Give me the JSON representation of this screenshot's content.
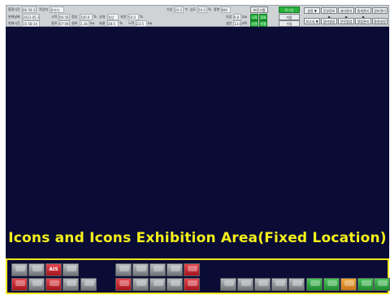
{
  "status_bar": {
    "row1": [
      "통합시간",
      "06:58:33",
      "작업자",
      "관리자",
      "기상",
      "20.0",
      "℃",
      "습도",
      "50.0",
      "%",
      "풍향",
      "NW",
      "프로그램",
      "로그인"
    ],
    "row2": [
      "현재날짜",
      "2023-05-15",
      "시작",
      "06:56",
      "정상",
      "100.0",
      "%",
      "상태",
      "정상",
      "유량",
      "50.0",
      "% ",
      "유압",
      "9.8",
      "bar"
    ],
    "row3": [
      "현재시간",
      "15:58:14",
      "종료",
      "07:06",
      "설비",
      "1.36",
      "kw",
      "효율",
      "28.5",
      "%",
      "누적",
      "23.5",
      "kw",
      "생산",
      "13.8",
      "kPa"
    ],
    "buttons": {
      "start": "시작",
      "stop": "정지",
      "auto": "자동",
      "manual": "수동",
      "reset": "리셋",
      "connect": "연결"
    },
    "menu": [
      "설정 ▼",
      "운영정보 ▼",
      "설비관리 ▼",
      "통계관리 ▼",
      "정보관리",
      "보고서 ▼",
      "장비설정 ▼",
      "안전점검 ▼",
      "알람관리 ▼",
      "환경설정 ▼"
    ]
  },
  "caption": "Icons and Icons Exhibition Area(Fixed Location)",
  "tiles": [
    {
      "id": "t1",
      "label": "",
      "color": "gray"
    },
    {
      "id": "t2",
      "label": "",
      "color": "gray"
    },
    {
      "id": "t3",
      "label": "AIS",
      "color": "red"
    },
    {
      "id": "t4",
      "label": "",
      "color": "gray"
    },
    {
      "id": "t5",
      "label": "",
      "color": "red"
    },
    {
      "id": "t6",
      "label": "",
      "color": "gray"
    },
    {
      "id": "t7",
      "label": "",
      "color": "red"
    },
    {
      "id": "t8",
      "label": "",
      "color": "gray"
    },
    {
      "id": "t9",
      "label": "",
      "color": "gray"
    },
    {
      "id": "t10",
      "label": "",
      "color": "gray"
    },
    {
      "id": "t11",
      "label": "",
      "color": "gray"
    },
    {
      "id": "t12",
      "label": "",
      "color": "gray"
    },
    {
      "id": "t13",
      "label": "",
      "color": "gray"
    },
    {
      "id": "t14",
      "label": "",
      "color": "red"
    },
    {
      "id": "t15",
      "label": "",
      "color": "red"
    },
    {
      "id": "t16",
      "label": "",
      "color": "gray"
    },
    {
      "id": "t17",
      "label": "",
      "color": "gray"
    },
    {
      "id": "t18",
      "label": "",
      "color": "gray"
    },
    {
      "id": "t19",
      "label": "",
      "color": "red"
    },
    {
      "id": "t20",
      "label": "",
      "color": "gray"
    },
    {
      "id": "t21",
      "label": "",
      "color": "gray"
    },
    {
      "id": "t22",
      "label": "",
      "color": "gray"
    },
    {
      "id": "t23",
      "label": "",
      "color": "gray"
    },
    {
      "id": "t24",
      "label": "",
      "color": "gray"
    },
    {
      "id": "t25",
      "label": "",
      "color": "green"
    },
    {
      "id": "t26",
      "label": "",
      "color": "green"
    },
    {
      "id": "t27",
      "label": "",
      "color": "orange"
    },
    {
      "id": "t28",
      "label": "",
      "color": "green"
    },
    {
      "id": "t29",
      "label": "",
      "color": "green"
    }
  ]
}
